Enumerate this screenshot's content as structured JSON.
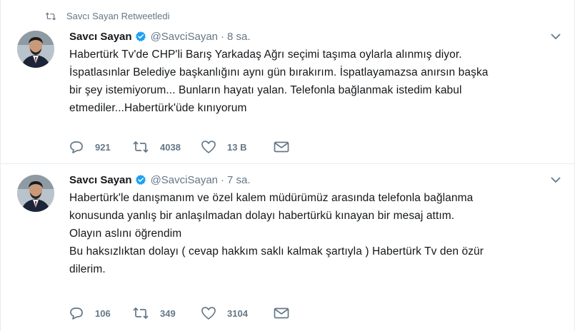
{
  "retweet_context": {
    "label": "Savcı Sayan Retweetledi",
    "icon": "retweet-icon"
  },
  "colors": {
    "secondary": "#657786",
    "verified": "#1da1f2",
    "text": "#14171a",
    "divider": "#e6ecf0"
  },
  "tweets": [
    {
      "author": {
        "name": "Savcı Sayan",
        "handle": "@SavciSayan",
        "verified_icon": "verified-badge-icon"
      },
      "separator": "·",
      "time": "8 sa.",
      "lines": [
        "Habertürk Tv'de CHP'li Barış Yarkadaş Ağrı seçimi taşıma oylarla alınmış diyor.",
        "İspatlasınlar Belediye başkanlığını aynı gün bırakırım. İspatlayamazsa anırsın başka",
        "bir şey istemiyorum... Bunların hayatı yalan. Telefonla bağlanmak istedim kabul",
        "etmediler...Habertürk'üde kınıyorum"
      ],
      "stats": {
        "replies": "921",
        "retweets": "4038",
        "likes": "13 B"
      }
    },
    {
      "author": {
        "name": "Savcı Sayan",
        "handle": "@SavciSayan",
        "verified_icon": "verified-badge-icon"
      },
      "separator": "·",
      "time": "7 sa.",
      "lines": [
        "Habertürk'le danışmanım ve özel kalem müdürümüz arasında telefonla bağlanma",
        "konusunda yanlış bir anlaşılmadan dolayı habertürkü kınayan bir mesaj attım.",
        "Olayın aslını öğrendim",
        "Bu haksızlıktan dolayı ( cevap hakkım saklı kalmak şartıyla ) Habertürk Tv den özür",
        "dilerim."
      ],
      "stats": {
        "replies": "106",
        "retweets": "349",
        "likes": "3104"
      }
    }
  ]
}
